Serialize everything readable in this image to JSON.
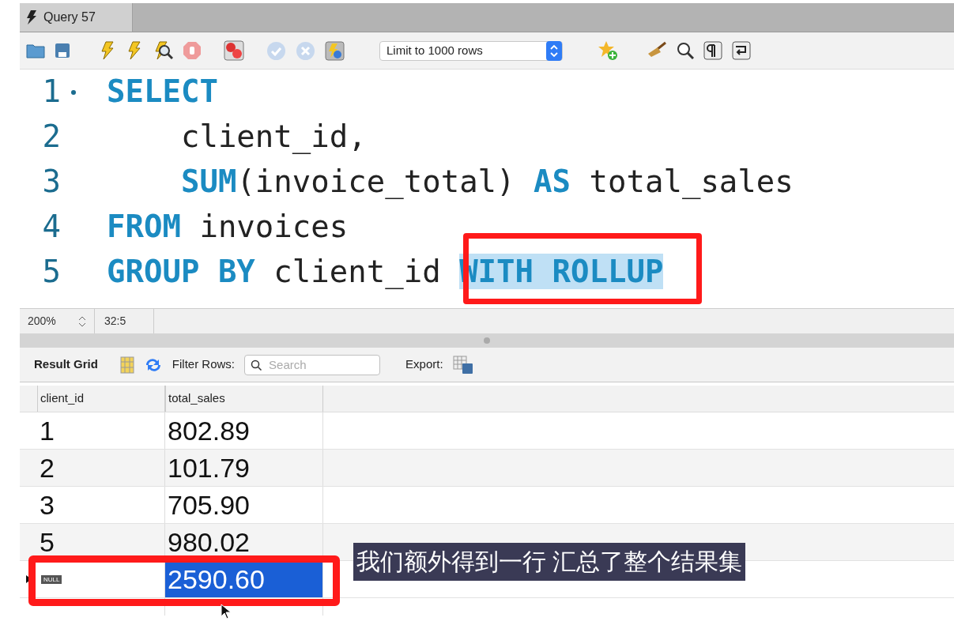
{
  "tab": {
    "title": "Query 57"
  },
  "toolbar": {
    "limit_select": "Limit to 1000 rows"
  },
  "editor": {
    "lines": [
      {
        "number": "1",
        "marked": true,
        "tokens": [
          {
            "text": "SELECT",
            "kind": "keyword",
            "selected": false
          }
        ]
      },
      {
        "number": "2",
        "marked": false,
        "tokens": [
          {
            "text": "    client_id,",
            "kind": "plain",
            "selected": false
          }
        ]
      },
      {
        "number": "3",
        "marked": false,
        "tokens": [
          {
            "text": "    SUM",
            "kind": "keyword",
            "selected": false
          },
          {
            "text": "(invoice_total) ",
            "kind": "plain",
            "selected": false
          },
          {
            "text": "AS",
            "kind": "keyword",
            "selected": false
          },
          {
            "text": " total_sales",
            "kind": "plain",
            "selected": false
          }
        ]
      },
      {
        "number": "4",
        "marked": false,
        "tokens": [
          {
            "text": "FROM",
            "kind": "keyword",
            "selected": false
          },
          {
            "text": " invoices",
            "kind": "plain",
            "selected": false
          }
        ]
      },
      {
        "number": "5",
        "marked": false,
        "tokens": [
          {
            "text": "GROUP BY",
            "kind": "keyword",
            "selected": false
          },
          {
            "text": " client_id ",
            "kind": "plain",
            "selected": false
          },
          {
            "text": "WITH ROLLUP",
            "kind": "keyword",
            "selected": true
          }
        ]
      }
    ]
  },
  "status_bar": {
    "zoom": "200%",
    "cursor": "32:5"
  },
  "result_toolbar": {
    "title": "Result Grid",
    "filter_label": "Filter Rows:",
    "search_placeholder": "Search",
    "export_label": "Export:"
  },
  "table": {
    "columns": [
      "client_id",
      "total_sales"
    ],
    "rows": [
      {
        "current": false,
        "cells": [
          {
            "kind": "text",
            "text": "1",
            "selected": false
          },
          {
            "kind": "text",
            "text": "802.89",
            "selected": false
          }
        ]
      },
      {
        "current": false,
        "cells": [
          {
            "kind": "text",
            "text": "2",
            "selected": false
          },
          {
            "kind": "text",
            "text": "101.79",
            "selected": false
          }
        ]
      },
      {
        "current": false,
        "cells": [
          {
            "kind": "text",
            "text": "3",
            "selected": false
          },
          {
            "kind": "text",
            "text": "705.90",
            "selected": false
          }
        ]
      },
      {
        "current": false,
        "cells": [
          {
            "kind": "text",
            "text": "5",
            "selected": false
          },
          {
            "kind": "text",
            "text": "980.02",
            "selected": false
          }
        ]
      },
      {
        "current": true,
        "cells": [
          {
            "kind": "null",
            "text": "NULL",
            "selected": false
          },
          {
            "kind": "text",
            "text": "2590.60",
            "selected": true
          }
        ]
      }
    ]
  },
  "caption": "我们额外得到一行 汇总了整个结果集"
}
